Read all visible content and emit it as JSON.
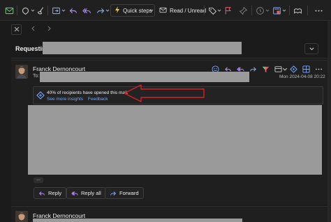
{
  "toolbar": {
    "quick_steps_label": "Quick steps",
    "read_unread_label": "Read / Unread",
    "icons": [
      "new-mail-icon",
      "tag-icon",
      "broom-icon",
      "move-icon",
      "reply-icon",
      "reply-all-icon",
      "forward-icon",
      "quick-steps-icon",
      "envelope-icon",
      "tag-icon",
      "flag-icon",
      "pin-icon",
      "clock-icon",
      "rules-icon",
      "immersive-reader-icon"
    ]
  },
  "conversation": {
    "subject_prefix": "Requesting"
  },
  "message": {
    "sender": "Franck Dernoncourt",
    "to_label": "To:",
    "date": "Mon 2024-04-08 20:22",
    "insight_text": "40% of recipients have opened this mail.",
    "see_more_label": "See more insights",
    "feedback_label": "Feedback",
    "more_label": "...",
    "reply_label": "Reply",
    "reply_all_label": "Reply all",
    "forward_label": "Forward"
  },
  "message2": {
    "sender": "Franck Dernoncourt"
  },
  "colors": {
    "accent": "#6aa8ff",
    "annotation_arrow": "#d81f26",
    "redaction": "#9a9a9a"
  }
}
